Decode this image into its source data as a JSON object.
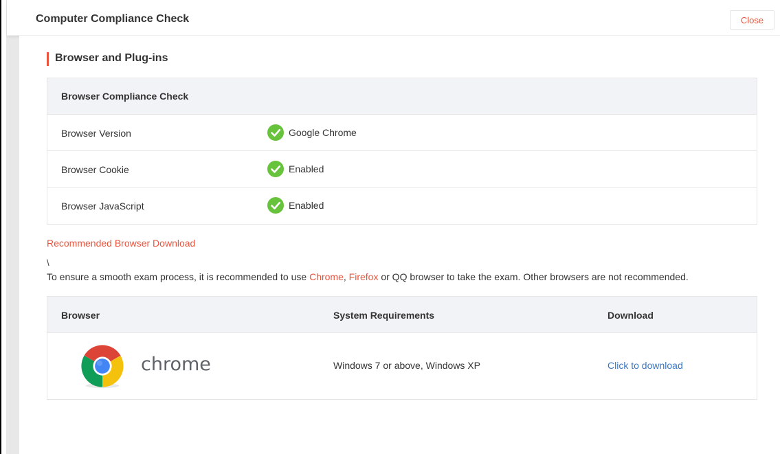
{
  "header": {
    "title": "Computer Compliance Check",
    "close_label": "Close"
  },
  "section": {
    "title": "Browser and Plug-ins"
  },
  "compliance": {
    "heading": "Browser Compliance Check",
    "rows": [
      {
        "label": "Browser Version",
        "value": "Google Chrome",
        "status": "pass"
      },
      {
        "label": "Browser Cookie",
        "value": "Enabled",
        "status": "pass"
      },
      {
        "label": "Browser JavaScript",
        "value": "Enabled",
        "status": "pass"
      }
    ]
  },
  "recommend": {
    "link_label": "Recommended Browser Download",
    "stray_char": "\\",
    "notice_before": "To ensure a smooth exam process, it is recommended to use ",
    "chrome_link": "Chrome",
    "separator": ", ",
    "firefox_link": "Firefox",
    "notice_after": " or QQ browser to take the exam. Other browsers are not recommended."
  },
  "downloads": {
    "headers": {
      "browser": "Browser",
      "requirements": "System Requirements",
      "download": "Download"
    },
    "rows": [
      {
        "browser_name": "chrome",
        "requirements": "Windows 7 or above, Windows XP",
        "download_label": "Click to download",
        "icon": "chrome-logo-icon"
      }
    ]
  },
  "colors": {
    "accent": "#e8553e",
    "success": "#68c33c",
    "link": "#3a78c3",
    "table_header_bg": "#f2f3f6"
  }
}
